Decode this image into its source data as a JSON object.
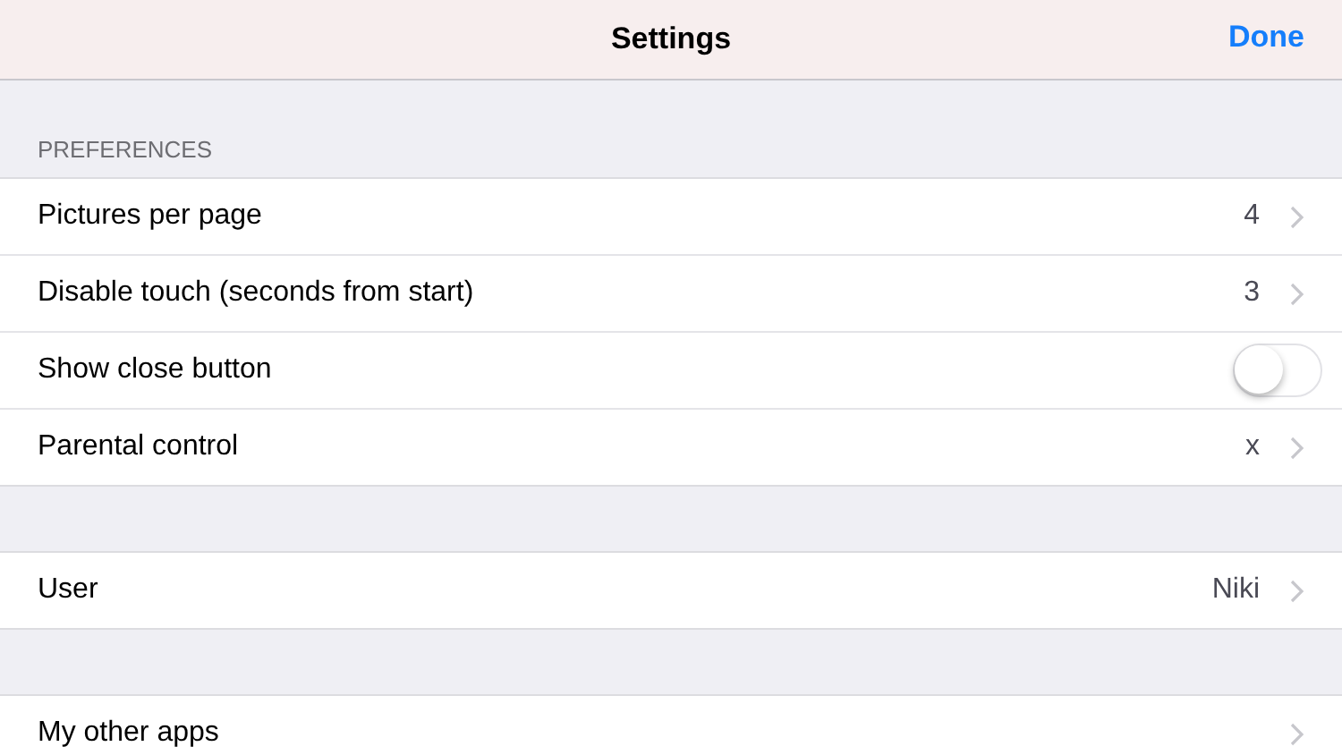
{
  "nav_bar": {
    "title": "Settings",
    "done_button": "Done"
  },
  "sections": [
    {
      "header": "PREFERENCES",
      "rows": [
        {
          "kind": "disclosure",
          "label": "Pictures per page",
          "value": "4"
        },
        {
          "kind": "disclosure",
          "label": "Disable touch (seconds from start)",
          "value": "3"
        },
        {
          "kind": "toggle",
          "label": "Show close button",
          "on": false
        },
        {
          "kind": "disclosure",
          "label": "Parental control",
          "value": "x"
        }
      ]
    },
    {
      "rows": [
        {
          "kind": "disclosure",
          "label": "User",
          "value": "Niki"
        }
      ]
    },
    {
      "rows": [
        {
          "kind": "disclosure",
          "label": "My other apps"
        }
      ]
    }
  ]
}
